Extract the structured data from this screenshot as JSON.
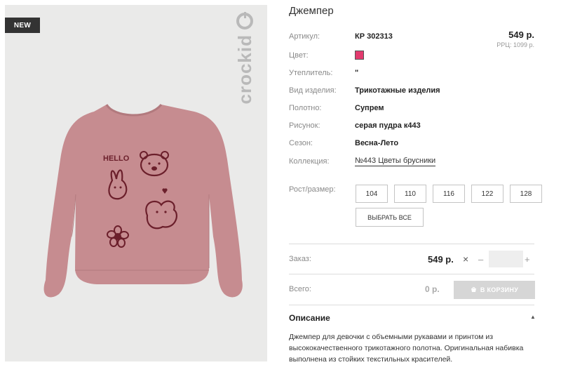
{
  "product": {
    "badge": "NEW",
    "brand": "crockid",
    "title": "Джемпер",
    "price": "549 р.",
    "rrp": "РРЦ: 1099 р.",
    "attributes": [
      {
        "label": "Артикул:",
        "value": "КР 302313"
      },
      {
        "label": "Цвет:",
        "value": ""
      },
      {
        "label": "Утеплитель:",
        "value": "\""
      },
      {
        "label": "Вид изделия:",
        "value": "Трикотажные изделия"
      },
      {
        "label": "Полотно:",
        "value": "Супрем"
      },
      {
        "label": "Рисунок:",
        "value": "серая пудра к443"
      },
      {
        "label": "Сезон:",
        "value": "Весна-Лето"
      },
      {
        "label": "Коллекция:",
        "value": "№443 Цветы брусники"
      }
    ],
    "color_swatch": "#e23a6e"
  },
  "sizes": {
    "label": "Рост/размер:",
    "options": [
      "104",
      "110",
      "116",
      "122",
      "128"
    ],
    "select_all": "ВЫБРАТЬ ВСЕ"
  },
  "order": {
    "label": "Заказ:",
    "price": "549 р.",
    "times": "×",
    "minus": "–",
    "plus": "+",
    "quantity": ""
  },
  "total": {
    "label": "Всего:",
    "value": "0 р.",
    "cart_button": "В КОРЗИНУ"
  },
  "description": {
    "title": "Описание",
    "caret": "▲",
    "text": "Джемпер для девочки с объемными рукавами и принтом из высококачественного трикотажного полотна. Оригинальная набивка выполнена из стойких текстильных красителей."
  },
  "print": {
    "hello": "HELLO"
  }
}
